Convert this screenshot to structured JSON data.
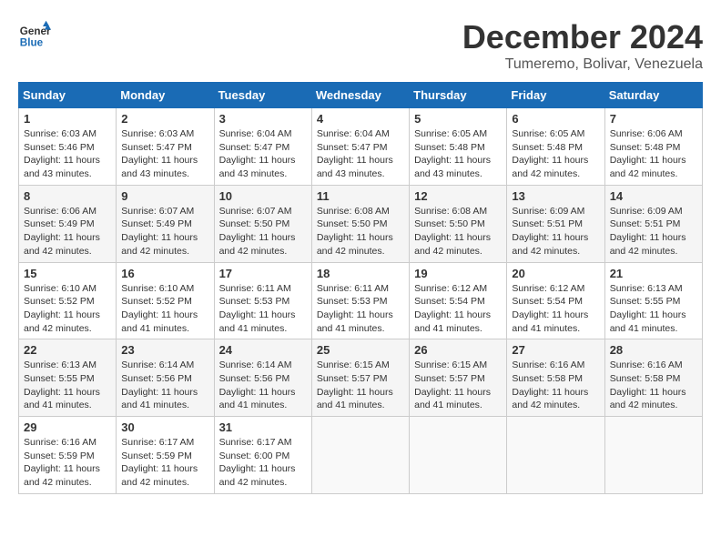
{
  "header": {
    "logo_line1": "General",
    "logo_line2": "Blue",
    "month_title": "December 2024",
    "subtitle": "Tumeremo, Bolivar, Venezuela"
  },
  "calendar": {
    "days_of_week": [
      "Sunday",
      "Monday",
      "Tuesday",
      "Wednesday",
      "Thursday",
      "Friday",
      "Saturday"
    ],
    "weeks": [
      [
        {
          "day": "",
          "info": ""
        },
        {
          "day": "2",
          "info": "Sunrise: 6:03 AM\nSunset: 5:47 PM\nDaylight: 11 hours\nand 43 minutes."
        },
        {
          "day": "3",
          "info": "Sunrise: 6:04 AM\nSunset: 5:47 PM\nDaylight: 11 hours\nand 43 minutes."
        },
        {
          "day": "4",
          "info": "Sunrise: 6:04 AM\nSunset: 5:47 PM\nDaylight: 11 hours\nand 43 minutes."
        },
        {
          "day": "5",
          "info": "Sunrise: 6:05 AM\nSunset: 5:48 PM\nDaylight: 11 hours\nand 43 minutes."
        },
        {
          "day": "6",
          "info": "Sunrise: 6:05 AM\nSunset: 5:48 PM\nDaylight: 11 hours\nand 42 minutes."
        },
        {
          "day": "7",
          "info": "Sunrise: 6:06 AM\nSunset: 5:48 PM\nDaylight: 11 hours\nand 42 minutes."
        }
      ],
      [
        {
          "day": "8",
          "info": "Sunrise: 6:06 AM\nSunset: 5:49 PM\nDaylight: 11 hours\nand 42 minutes."
        },
        {
          "day": "9",
          "info": "Sunrise: 6:07 AM\nSunset: 5:49 PM\nDaylight: 11 hours\nand 42 minutes."
        },
        {
          "day": "10",
          "info": "Sunrise: 6:07 AM\nSunset: 5:50 PM\nDaylight: 11 hours\nand 42 minutes."
        },
        {
          "day": "11",
          "info": "Sunrise: 6:08 AM\nSunset: 5:50 PM\nDaylight: 11 hours\nand 42 minutes."
        },
        {
          "day": "12",
          "info": "Sunrise: 6:08 AM\nSunset: 5:50 PM\nDaylight: 11 hours\nand 42 minutes."
        },
        {
          "day": "13",
          "info": "Sunrise: 6:09 AM\nSunset: 5:51 PM\nDaylight: 11 hours\nand 42 minutes."
        },
        {
          "day": "14",
          "info": "Sunrise: 6:09 AM\nSunset: 5:51 PM\nDaylight: 11 hours\nand 42 minutes."
        }
      ],
      [
        {
          "day": "15",
          "info": "Sunrise: 6:10 AM\nSunset: 5:52 PM\nDaylight: 11 hours\nand 42 minutes."
        },
        {
          "day": "16",
          "info": "Sunrise: 6:10 AM\nSunset: 5:52 PM\nDaylight: 11 hours\nand 41 minutes."
        },
        {
          "day": "17",
          "info": "Sunrise: 6:11 AM\nSunset: 5:53 PM\nDaylight: 11 hours\nand 41 minutes."
        },
        {
          "day": "18",
          "info": "Sunrise: 6:11 AM\nSunset: 5:53 PM\nDaylight: 11 hours\nand 41 minutes."
        },
        {
          "day": "19",
          "info": "Sunrise: 6:12 AM\nSunset: 5:54 PM\nDaylight: 11 hours\nand 41 minutes."
        },
        {
          "day": "20",
          "info": "Sunrise: 6:12 AM\nSunset: 5:54 PM\nDaylight: 11 hours\nand 41 minutes."
        },
        {
          "day": "21",
          "info": "Sunrise: 6:13 AM\nSunset: 5:55 PM\nDaylight: 11 hours\nand 41 minutes."
        }
      ],
      [
        {
          "day": "22",
          "info": "Sunrise: 6:13 AM\nSunset: 5:55 PM\nDaylight: 11 hours\nand 41 minutes."
        },
        {
          "day": "23",
          "info": "Sunrise: 6:14 AM\nSunset: 5:56 PM\nDaylight: 11 hours\nand 41 minutes."
        },
        {
          "day": "24",
          "info": "Sunrise: 6:14 AM\nSunset: 5:56 PM\nDaylight: 11 hours\nand 41 minutes."
        },
        {
          "day": "25",
          "info": "Sunrise: 6:15 AM\nSunset: 5:57 PM\nDaylight: 11 hours\nand 41 minutes."
        },
        {
          "day": "26",
          "info": "Sunrise: 6:15 AM\nSunset: 5:57 PM\nDaylight: 11 hours\nand 41 minutes."
        },
        {
          "day": "27",
          "info": "Sunrise: 6:16 AM\nSunset: 5:58 PM\nDaylight: 11 hours\nand 42 minutes."
        },
        {
          "day": "28",
          "info": "Sunrise: 6:16 AM\nSunset: 5:58 PM\nDaylight: 11 hours\nand 42 minutes."
        }
      ],
      [
        {
          "day": "29",
          "info": "Sunrise: 6:16 AM\nSunset: 5:59 PM\nDaylight: 11 hours\nand 42 minutes."
        },
        {
          "day": "30",
          "info": "Sunrise: 6:17 AM\nSunset: 5:59 PM\nDaylight: 11 hours\nand 42 minutes."
        },
        {
          "day": "31",
          "info": "Sunrise: 6:17 AM\nSunset: 6:00 PM\nDaylight: 11 hours\nand 42 minutes."
        },
        {
          "day": "",
          "info": ""
        },
        {
          "day": "",
          "info": ""
        },
        {
          "day": "",
          "info": ""
        },
        {
          "day": "",
          "info": ""
        }
      ]
    ],
    "week1_sun": {
      "day": "1",
      "info": "Sunrise: 6:03 AM\nSunset: 5:46 PM\nDaylight: 11 hours\nand 43 minutes."
    }
  }
}
